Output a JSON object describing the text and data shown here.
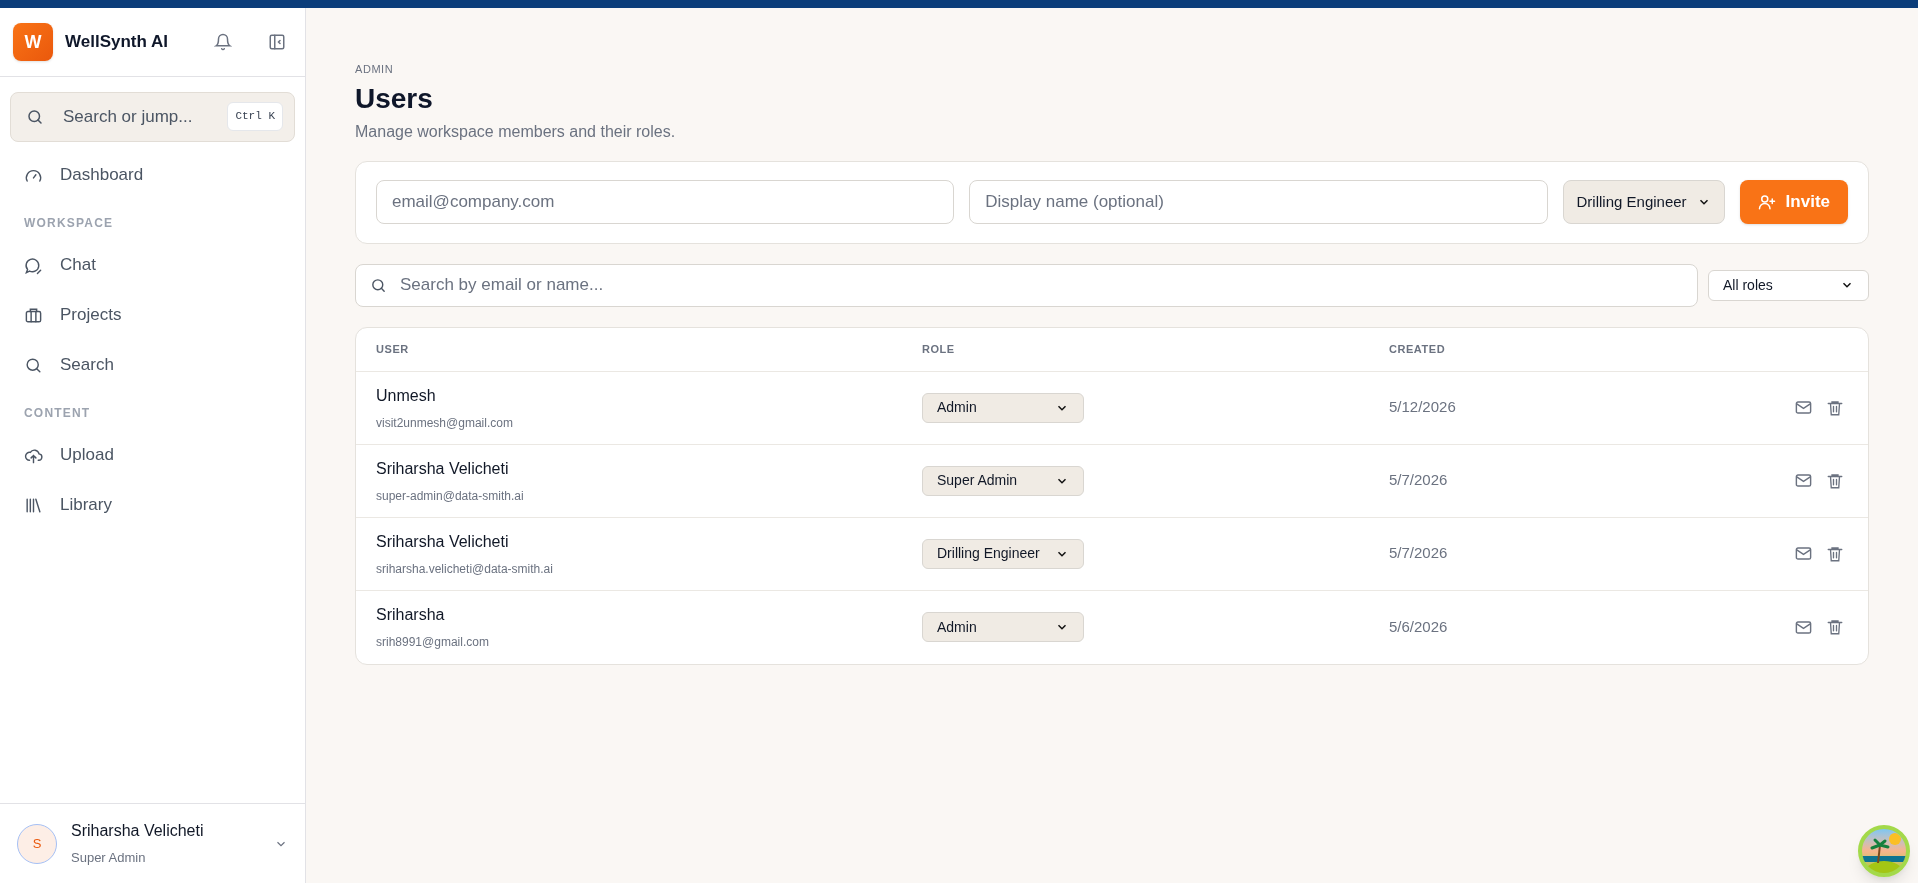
{
  "brand": {
    "logo_letter": "W",
    "name": "WellSynth AI"
  },
  "sidebar": {
    "search": {
      "placeholder": "Search or jump...",
      "shortcut": "Ctrl K"
    },
    "items": [
      {
        "kind": "link",
        "label": "Dashboard",
        "selected": false
      },
      {
        "kind": "heading",
        "label": "WORKSPACE"
      },
      {
        "kind": "link",
        "label": "Chat",
        "selected": false
      },
      {
        "kind": "link",
        "label": "Projects",
        "selected": false
      },
      {
        "kind": "link",
        "label": "Search",
        "selected": false
      },
      {
        "kind": "heading",
        "label": "CONTENT"
      },
      {
        "kind": "link",
        "label": "Upload",
        "selected": false
      },
      {
        "kind": "link",
        "label": "Library",
        "selected": false
      }
    ],
    "user": {
      "initial": "S",
      "name": "Sriharsha Velicheti",
      "role": "Super Admin"
    }
  },
  "page": {
    "eyebrow": "ADMIN",
    "title": "Users",
    "subtitle": "Manage workspace members and their roles."
  },
  "invite_form": {
    "email": {
      "placeholder": "email@company.com"
    },
    "display_name": {
      "placeholder": "Display name (optional)"
    },
    "role": "Drilling Engineer",
    "button": "Invite"
  },
  "filter": {
    "search": {
      "placeholder": "Search by email or name..."
    },
    "role": "All roles"
  },
  "table": {
    "columns": [
      "USER",
      "ROLE",
      "CREATED"
    ],
    "rows": [
      {
        "name": "Unmesh",
        "email": "visit2unmesh@gmail.com",
        "role": "Admin",
        "created": "5/12/2026"
      },
      {
        "name": "Sriharsha Velicheti",
        "email": "super-admin@data-smith.ai",
        "role": "Super Admin",
        "created": "5/7/2026"
      },
      {
        "name": "Sriharsha Velicheti",
        "email": "sriharsha.velicheti@data-smith.ai",
        "role": "Drilling Engineer",
        "created": "5/7/2026"
      },
      {
        "name": "Sriharsha",
        "email": "srih8991@gmail.com",
        "role": "Admin",
        "created": "5/6/2026"
      }
    ]
  }
}
